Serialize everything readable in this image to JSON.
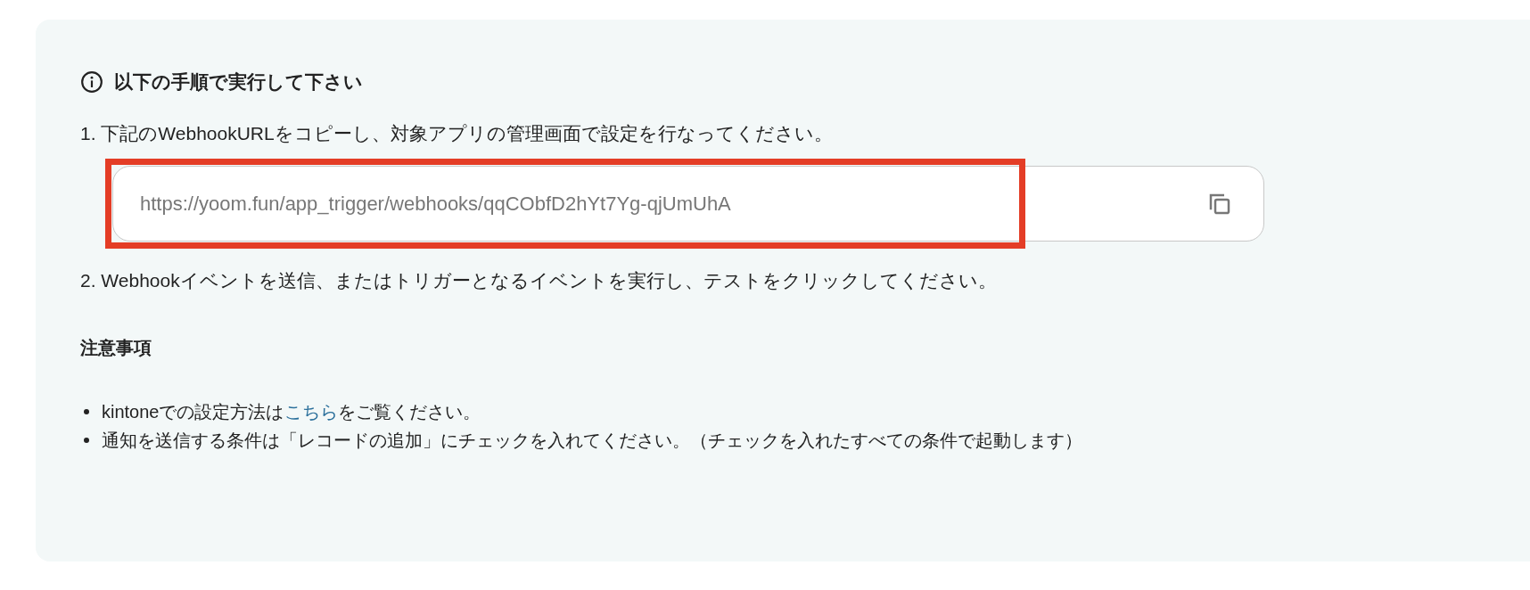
{
  "panel": {
    "heading": "以下の手順で実行して下さい",
    "steps": [
      {
        "number": "1.",
        "text": "下記のWebhookURLをコピーし、対象アプリの管理画面で設定を行なってください。"
      },
      {
        "number": "2.",
        "text": "Webhookイベントを送信、またはトリガーとなるイベントを実行し、テストをクリックしてください。"
      }
    ],
    "webhook_field": {
      "value": "https://yoom.fun/app_trigger/webhooks/qqCObfD2hYt7Yg-qjUmUhA",
      "highlighted": true
    },
    "notes_title": "注意事項",
    "notes": [
      {
        "text_before": "kintoneでの設定方法は",
        "link": "こちら",
        "text_after": "をご覧ください。"
      },
      {
        "text_before": "通知を送信する条件は「レコードの追加」にチェックを入れてください。（チェックを入れたすべての条件で起動します）"
      }
    ]
  }
}
